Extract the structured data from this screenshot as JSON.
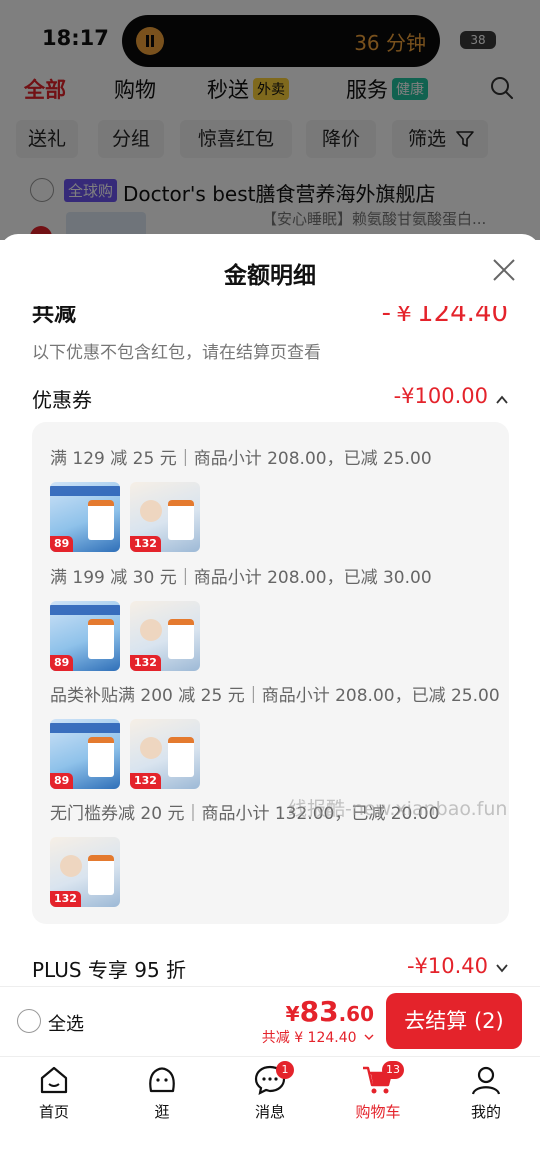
{
  "status_bar": {
    "time": "18:17",
    "timer": "36 分钟",
    "battery": "38"
  },
  "top_tabs": [
    {
      "label": "全部"
    },
    {
      "label": "购物"
    },
    {
      "label": "秒送",
      "badge": "外卖"
    },
    {
      "label": "服务",
      "badge": "健康"
    }
  ],
  "filters": [
    "送礼",
    "分组",
    "惊喜红包",
    "降价",
    "筛选"
  ],
  "store": {
    "badge": "全球购",
    "name": "Doctor's best膳食营养海外旗舰店",
    "item_snippet": "【安心睡眠】赖氨酸甘氨酸蛋白..."
  },
  "sheet": {
    "title": "金额明细",
    "total_label": "共减",
    "total_value": "-￥124.40",
    "hint": "以下优惠不包含红包，请在结算页查看",
    "coupon_label": "优惠券",
    "coupon_value": "-¥100.00",
    "coupon_rules": [
      {
        "text": "满 129 减 25 元｜商品小计 208.00，已减 25.00",
        "thumbs": [
          "89",
          "132"
        ]
      },
      {
        "text": "满 199 减 30 元｜商品小计 208.00，已减 30.00",
        "thumbs": [
          "89",
          "132"
        ]
      },
      {
        "text": "品类补贴满 200 减 25 元｜商品小计 208.00，已减 25.00",
        "thumbs": [
          "89",
          "132"
        ]
      },
      {
        "text": "无门槛券减 20 元｜商品小计 132.00，已减 20.00",
        "thumbs": [
          "132"
        ]
      }
    ],
    "plus_label": "PLUS 专享 95 折",
    "plus_value": "-¥10.40"
  },
  "watermark": "线报酷-new.xianbao.fun",
  "checkout": {
    "select_all": "全选",
    "currency": "¥",
    "price_int": "83",
    "price_dec": ".60",
    "discount": "共减 ¥ 124.40",
    "button": "去结算 (2)"
  },
  "bottom_nav": [
    {
      "label": "首页",
      "icon": "home-icon"
    },
    {
      "label": "逛",
      "icon": "browse-icon"
    },
    {
      "label": "消息",
      "icon": "message-icon",
      "badge": "1"
    },
    {
      "label": "购物车",
      "icon": "cart-icon",
      "badge": "13",
      "active": true
    },
    {
      "label": "我的",
      "icon": "profile-icon"
    }
  ],
  "colors": {
    "accent": "#e4232b",
    "global_badge": "#6d54f2"
  }
}
